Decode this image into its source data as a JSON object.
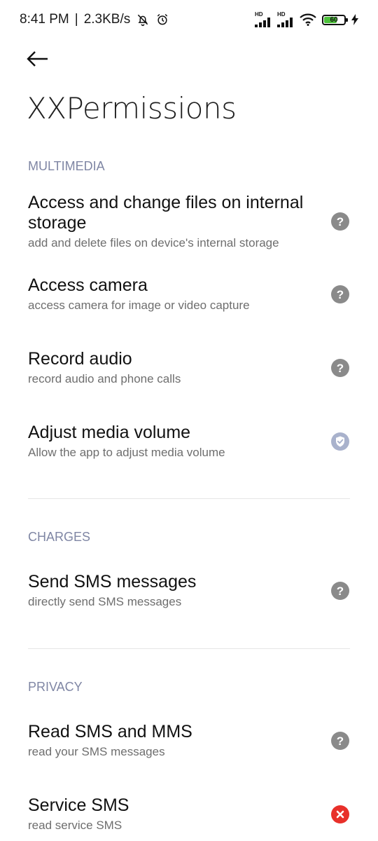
{
  "status_bar": {
    "time": "8:41 PM",
    "separator": "|",
    "speed": "2.3KB/s",
    "battery_percent": "60",
    "sim1_label": "HD",
    "sim2_label": "HD"
  },
  "header": {
    "title": "XXPermissions"
  },
  "sections": {
    "multimedia": {
      "label": "MULTIMEDIA",
      "items": [
        {
          "title": "Access and change files on internal storage",
          "subtitle": "add and delete files on device's internal storage",
          "status": "ask"
        },
        {
          "title": "Access camera",
          "subtitle": "access camera for image or video capture",
          "status": "ask"
        },
        {
          "title": "Record audio",
          "subtitle": "record audio and phone calls",
          "status": "ask"
        },
        {
          "title": "Adjust media volume",
          "subtitle": "Allow the app to adjust media volume",
          "status": "allowed"
        }
      ]
    },
    "charges": {
      "label": "CHARGES",
      "items": [
        {
          "title": "Send SMS messages",
          "subtitle": "directly send SMS messages",
          "status": "ask"
        }
      ]
    },
    "privacy": {
      "label": "PRIVACY",
      "items": [
        {
          "title": "Read SMS and MMS",
          "subtitle": "read your SMS messages",
          "status": "ask"
        },
        {
          "title": "Service SMS",
          "subtitle": "read service SMS",
          "status": "denied"
        }
      ]
    }
  },
  "icons": {
    "ask": "question-circle-icon",
    "allowed": "shield-check-icon",
    "denied": "x-circle-icon"
  },
  "colors": {
    "ask": "#8a8a8a",
    "allowed": "#a9b2cc",
    "denied": "#e8302a",
    "section_header": "#7f86a4",
    "battery_fill": "#4cc13a"
  }
}
